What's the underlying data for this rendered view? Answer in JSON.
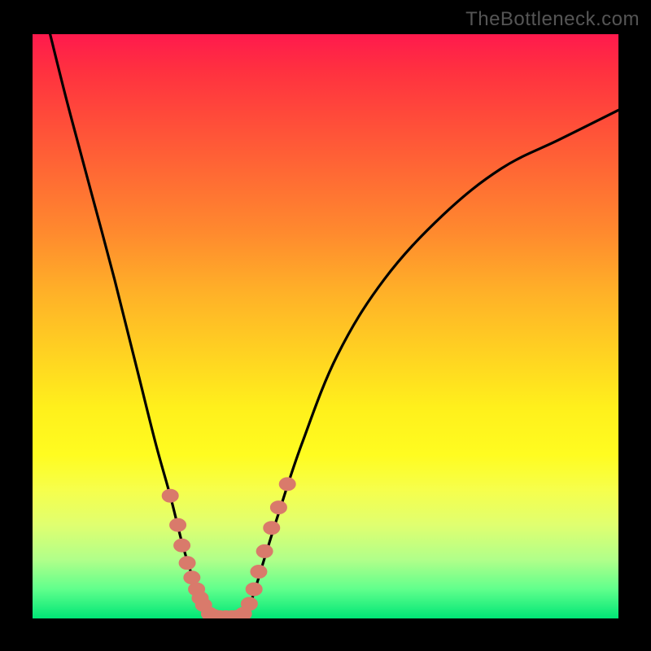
{
  "watermark": "TheBottleneck.com",
  "colors": {
    "background": "#000000",
    "curve": "#000000",
    "dots": "#d97a6b",
    "gradient_top": "#ff1a4d",
    "gradient_bottom": "#00e676"
  },
  "chart_data": {
    "type": "line",
    "title": "",
    "xlabel": "",
    "ylabel": "",
    "xlim": [
      0,
      100
    ],
    "ylim": [
      0,
      100
    ],
    "series": [
      {
        "name": "left-curve",
        "x": [
          3,
          6,
          10,
          14,
          18,
          21,
          23.5,
          25.5,
          27,
          28.2,
          29,
          29.7,
          30.2
        ],
        "y": [
          100,
          88,
          73,
          58,
          42,
          30,
          21,
          13,
          8,
          4.5,
          2.3,
          1.0,
          0.2
        ]
      },
      {
        "name": "floor",
        "x": [
          30.2,
          31.5,
          33.0,
          34.5,
          36.0
        ],
        "y": [
          0.2,
          0.0,
          0.0,
          0.0,
          0.2
        ]
      },
      {
        "name": "right-curve",
        "x": [
          36.0,
          37.5,
          39.5,
          42,
          46,
          52,
          60,
          70,
          80,
          90,
          100
        ],
        "y": [
          0.2,
          3.5,
          10,
          18,
          30,
          45,
          58,
          69,
          77,
          82,
          87
        ]
      }
    ],
    "highlighted_points": {
      "name": "observed-points",
      "x": [
        23.5,
        24.8,
        25.5,
        26.4,
        27.2,
        28.0,
        28.6,
        29.2,
        30.2,
        31.0,
        32.0,
        33.0,
        34.0,
        35.0,
        36.0,
        37.0,
        37.8,
        38.6,
        39.6,
        40.8,
        42.0,
        43.5
      ],
      "y": [
        21.0,
        16.0,
        12.5,
        9.5,
        7.0,
        5.0,
        3.5,
        2.3,
        0.8,
        0.4,
        0.2,
        0.2,
        0.2,
        0.3,
        0.8,
        2.5,
        5.0,
        8.0,
        11.5,
        15.5,
        19.0,
        23.0
      ]
    }
  }
}
